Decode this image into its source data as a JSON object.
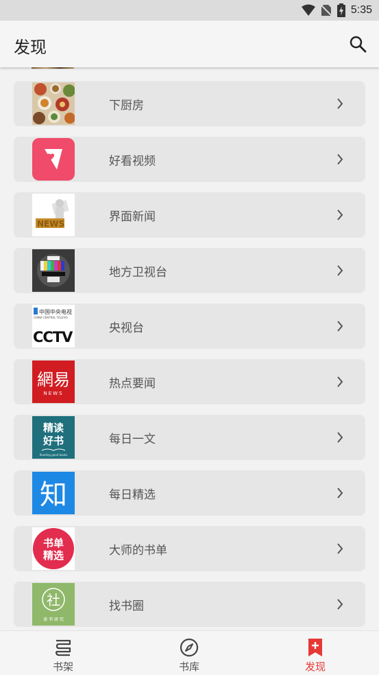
{
  "status_bar": {
    "time": "5:35",
    "icons": [
      "wifi-icon",
      "no-sim-icon",
      "battery-charging-icon"
    ]
  },
  "header": {
    "title": "发现",
    "search_icon": "search-icon"
  },
  "sources": [
    {
      "label": "下厨房",
      "thumb": "food-collage"
    },
    {
      "label": "好看视频",
      "thumb": "haokan-logo"
    },
    {
      "label": "界面新闻",
      "thumb": "news-figure"
    },
    {
      "label": "地方卫视台",
      "thumb": "tv-test-pattern"
    },
    {
      "label": "央视台",
      "thumb": "cctv-logo",
      "logo_text": "中国中央电视",
      "logo_sub": "CHINA CENTRAL TELEVIS",
      "logo_main": "CCTV"
    },
    {
      "label": "热点要闻",
      "thumb": "netease-news-logo",
      "logo_text": "網易",
      "logo_sub": "NEWS"
    },
    {
      "label": "每日一文",
      "thumb": "jingdu-logo",
      "logo_text": "精读",
      "logo_text2": "好书",
      "logo_sub": "Reading good books"
    },
    {
      "label": "每日精选",
      "thumb": "zhihu-logo",
      "logo_text": "知"
    },
    {
      "label": "大师的书单",
      "thumb": "shudan-logo",
      "logo_text": "书单",
      "logo_text2": "精选"
    },
    {
      "label": "找书圈",
      "thumb": "she-logo",
      "logo_text": "社",
      "logo_sub": "读 书 研 究"
    }
  ],
  "bottom_nav": [
    {
      "label": "书架",
      "icon": "bookshelf-icon",
      "active": false
    },
    {
      "label": "书库",
      "icon": "compass-icon",
      "active": false
    },
    {
      "label": "发现",
      "icon": "bookmark-plus-icon",
      "active": true
    }
  ],
  "colors": {
    "accent": "#e53935",
    "card": "#e6e6e6",
    "background": "#f2f2f2"
  }
}
